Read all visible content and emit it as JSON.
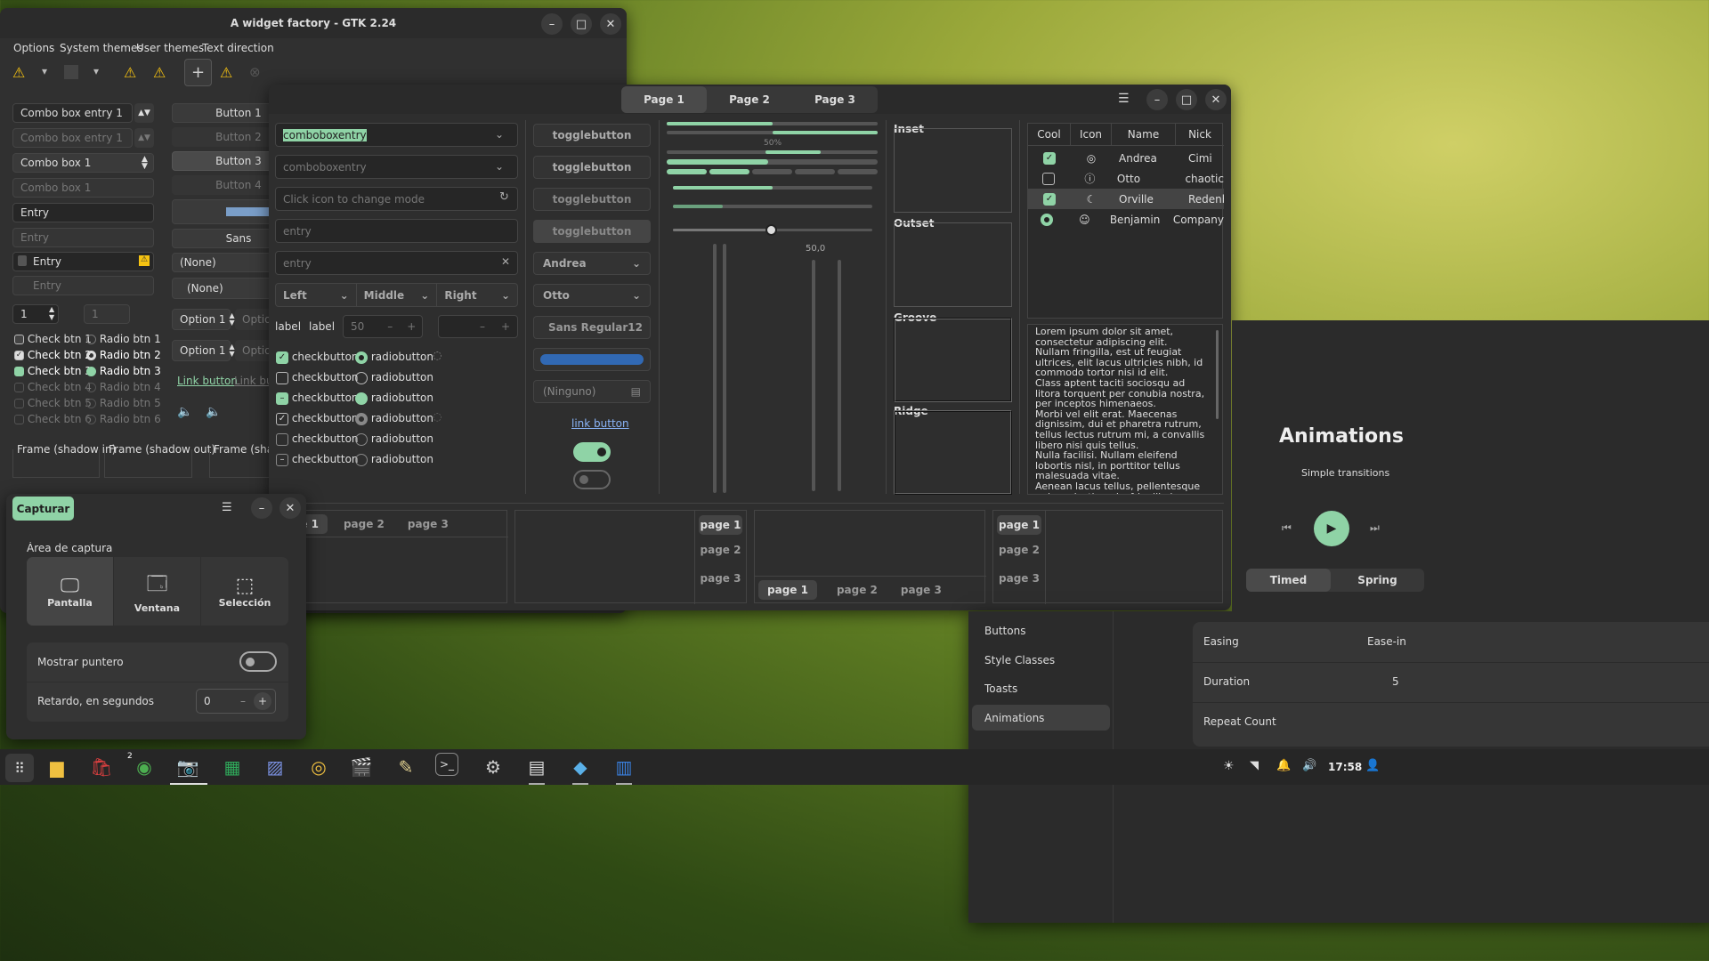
{
  "win1": {
    "title": "A widget factory - GTK 2.24",
    "menu": [
      "Options",
      "System themes",
      "User themes",
      "Text direction"
    ],
    "combo_entry1": "Combo box entry 1",
    "combo_entry1_dis": "Combo box entry 1",
    "combo1": "Combo box 1",
    "combo1_dis": "Combo box 1",
    "entry": "Entry",
    "entry_ph": "Entry",
    "entry_icon": "Entry",
    "entry_icon_dis": "Entry",
    "spin1": "1",
    "spin1_dis": "1",
    "checks": [
      "Check btn 1",
      "Check btn 2",
      "Check btn 3",
      "Check btn 4",
      "Check btn 5",
      "Check btn 6"
    ],
    "radios": [
      "Radio btn 1",
      "Radio btn 2",
      "Radio btn 3",
      "Radio btn 4",
      "Radio btn 5",
      "Radio btn 6"
    ],
    "buttons": [
      "Button 1",
      "Button 2",
      "Button 3",
      "Button 4"
    ],
    "font_btn": "Sans",
    "none1": "(None)",
    "none2": "(None)",
    "option1": "Option 1",
    "option1b": "Option 1",
    "option_dis": "Option",
    "option_dis2": "Option",
    "link": "Link button",
    "link2": "Link butt",
    "frames": [
      "Frame (shadow in)",
      "Frame (shadow out)",
      "Frame (shado"
    ]
  },
  "win2": {
    "tabs": [
      "Page 1",
      "Page 2",
      "Page 3"
    ],
    "comboentry1": "comboboxentry",
    "comboentry2": "comboboxentry",
    "mode_ph": "Click icon to change mode",
    "entry_ph": "entry",
    "entry2_ph": "entry",
    "seg": [
      "Left",
      "Middle",
      "Right"
    ],
    "label1": "label",
    "label2": "label",
    "spin": "50",
    "checks": [
      "checkbutton",
      "checkbutton",
      "checkbutton",
      "checkbutton",
      "checkbutton",
      "checkbutton"
    ],
    "radios": [
      "radiobutton",
      "radiobutton",
      "radiobutton",
      "radiobutton",
      "radiobutton",
      "radiobutton"
    ],
    "toggles": [
      "togglebutton",
      "togglebutton",
      "togglebutton",
      "togglebutton"
    ],
    "combo_andrea": "Andrea",
    "combo_otto": "Otto",
    "font": "Sans Regular",
    "font_size": "12",
    "ninguno": "(Ninguno)",
    "link": "link button",
    "pct_label": "50%",
    "scale_label": "50,0",
    "progress": [
      0.5,
      0.6,
      0.48,
      0.5,
      0.25
    ],
    "scale": 0.47,
    "frames": [
      "Inset",
      "Outset",
      "Groove",
      "Ridge"
    ],
    "table": {
      "headers": [
        "Cool",
        "Icon",
        "Name",
        "Nick"
      ],
      "rows": [
        {
          "name": "Andrea",
          "nick": "Cimi",
          "icon": "check-circle-icon"
        },
        {
          "name": "Otto",
          "nick": "chaotic",
          "icon": "alert-circle-icon"
        },
        {
          "name": "Orville",
          "nick": "Redenba...",
          "icon": "moon-icon"
        },
        {
          "name": "Benjamin",
          "nick": "Company",
          "icon": "face-icon"
        }
      ]
    },
    "lorem": "Lorem ipsum dolor sit amet, consectetur adipiscing elit.\nNullam fringilla, est ut feugiat ultrices, elit lacus ultricies nibh, id commodo tortor nisi id elit.\nClass aptent taciti sociosqu ad litora torquent per conubia nostra, per inceptos himenaeos.\nMorbi vel elit erat. Maecenas dignissim, dui et pharetra rutrum, tellus lectus rutrum mi, a convallis libero nisi quis tellus.\nNulla facilisi. Nullam eleifend lobortis nisl, in porttitor tellus malesuada vitae.\nAenean lacus tellus, pellentesque quis molestie quis, fringilla in arcu.\nDuis elementum, tellus sed tristique semper, metus metus accumsan augue, et porttitor augue orci a libero.",
    "nb_pages": [
      "page 1",
      "page 2",
      "page 3"
    ]
  },
  "capture": {
    "title_btn": "Capturar",
    "area_label": "Área de captura",
    "modes": [
      "Pantalla",
      "Ventana",
      "Selección"
    ],
    "pointer_label": "Mostrar puntero",
    "delay_label": "Retardo, en segundos",
    "delay_value": "0"
  },
  "adw": {
    "sidebar": [
      "Buttons",
      "Style Classes",
      "Toasts",
      "Animations"
    ],
    "title": "Animations",
    "subtitle": "Simple transitions",
    "seg": [
      "Timed",
      "Spring"
    ],
    "rows": [
      {
        "label": "Easing",
        "value": "Ease-in"
      },
      {
        "label": "Duration",
        "value": "5"
      },
      {
        "label": "Repeat Count",
        "value": ""
      }
    ]
  },
  "taskbar": {
    "clock": "17:58",
    "badge": "2"
  }
}
